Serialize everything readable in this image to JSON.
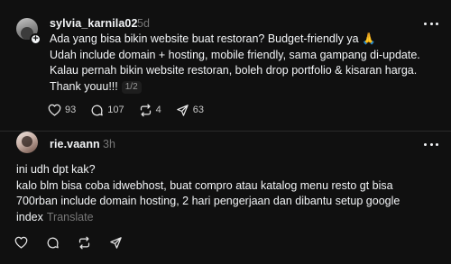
{
  "post1": {
    "username": "sylvia_karnila02",
    "time": "5d",
    "text": "Ada yang bisa bikin website buat restoran? Budget-friendly ya 🙏\nUdah include domain + hosting, mobile friendly, sama gampang di-update.\nKalau pernah bikin website restoran, boleh drop portfolio & kisaran harga.\nThank youu!!!",
    "pager": "1/2",
    "likes": "93",
    "replies": "107",
    "reposts": "4",
    "shares": "63"
  },
  "post2": {
    "username": "rie.vaann",
    "time": "3h",
    "text": "ini udh dpt kak?\nkalo blm bisa coba idwebhost, buat compro atau katalog menu resto gt bisa\n700rban include domain hosting, 2 hari pengerjaan dan dibantu setup google\nindex",
    "translate": "Translate"
  },
  "icons": {
    "like": "heart-icon",
    "reply": "comment-icon",
    "repost": "repost-icon",
    "share": "send-icon",
    "more": "more-horizontal-icon",
    "follow": "plus-icon"
  },
  "colors": {
    "background": "#101010",
    "text": "#f3f5f7",
    "muted": "#777777",
    "divider": "#2a2a2a"
  }
}
